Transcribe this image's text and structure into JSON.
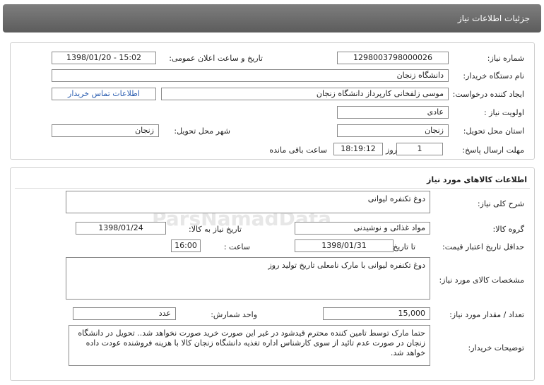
{
  "window_title": "جزئیات اطلاعات نیاز",
  "need_info": {
    "need_number_label": "شماره نیاز:",
    "need_number": "1298003798000026",
    "announce_label": "تاریخ و ساعت اعلان عمومی:",
    "announce_value": "1398/01/20 - 15:02",
    "buyer_org_label": "نام دستگاه خریدار:",
    "buyer_org": "دانشگاه زنجان",
    "requester_label": "ایجاد کننده درخواست:",
    "requester": "موسی زلفخانی کارپرداز دانشگاه زنجان",
    "contact_link": "اطلاعات تماس خریدار",
    "priority_label": "اولویت نیاز :",
    "priority": "عادی",
    "province_label": "استان محل تحویل:",
    "province": "زنجان",
    "city_label": "شهر محل تحویل:",
    "city": "زنجان",
    "deadline_label": "مهلت ارسال پاسخ:",
    "deadline_days": "1",
    "days_word": "روز و",
    "deadline_time": "18:19:12",
    "remaining_word": "ساعت باقی مانده"
  },
  "goods_info": {
    "section_title": "اطلاعات کالاهای مورد نیاز",
    "general_desc_label": "شرح کلی نیاز:",
    "general_desc": "دوغ تکنفره لیوانی",
    "goods_group_label": "گروه کالا:",
    "goods_group": "مواد غذائی و نوشیدنی",
    "need_date_label": "تاریخ نیاز به کالا:",
    "need_date": "1398/01/24",
    "min_validity_label": "حداقل تاریخ اعتبار قیمت:",
    "to_date_label": "تا تاریخ :",
    "to_date": "1398/01/31",
    "time_label": "ساعت :",
    "time_value": "16:00",
    "spec_label": "مشخصات کالای مورد نیاز:",
    "spec": "دوغ تکنفره لیوانی با مارک نامعلی تاریخ تولید روز",
    "quantity_label": "تعداد / مقدار مورد نیاز:",
    "quantity": "15,000",
    "unit_label": "واحد شمارش:",
    "unit": "عدد",
    "buyer_notes_label": "توضیحات خریدار:",
    "buyer_notes": "حتما مارک توسط تامین کننده محترم قیدشود در غیر این صورت خرید صورت نخواهد شد.. تحویل در دانشگاه زنجان در صورت عدم تائید از سوی کارشناس اداره تغذیه دانشگاه زنجان کالا با هزینه فروشنده عودت داده خواهد شد."
  }
}
